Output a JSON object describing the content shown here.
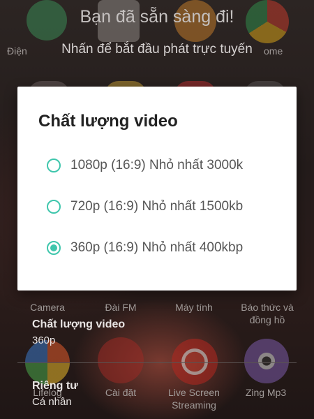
{
  "header": {
    "title": "Bạn đã sẵn sàng đi!",
    "subtitle": "Nhấn để bắt đầu phát trực tuyến"
  },
  "home_apps": {
    "top_left_partial": "Điện",
    "top_right_partial": "ome",
    "row_mid": [
      "Camera",
      "Đài FM",
      "Máy tính",
      "Báo thức và đồng hồ"
    ],
    "row_bottom": [
      "Lifelog",
      "Cài đặt",
      "Live Screen Streaming",
      "Zing Mp3"
    ]
  },
  "settings": {
    "quality_label": "Chất lượng video",
    "quality_value": "360p",
    "privacy_label": "Riêng tư",
    "privacy_value": "Cá nhân"
  },
  "dialog": {
    "title": "Chất lượng video",
    "options": [
      {
        "label": "1080p (16:9) Nhỏ nhất 3000k",
        "selected": false
      },
      {
        "label": "720p (16:9) Nhỏ nhất 1500kb",
        "selected": false
      },
      {
        "label": "360p (16:9) Nhỏ nhất 400kbp",
        "selected": true
      }
    ]
  },
  "colors": {
    "accent": "#3fc6ac",
    "dialog_bg": "#ffffff",
    "scrim": "#241c1b"
  }
}
